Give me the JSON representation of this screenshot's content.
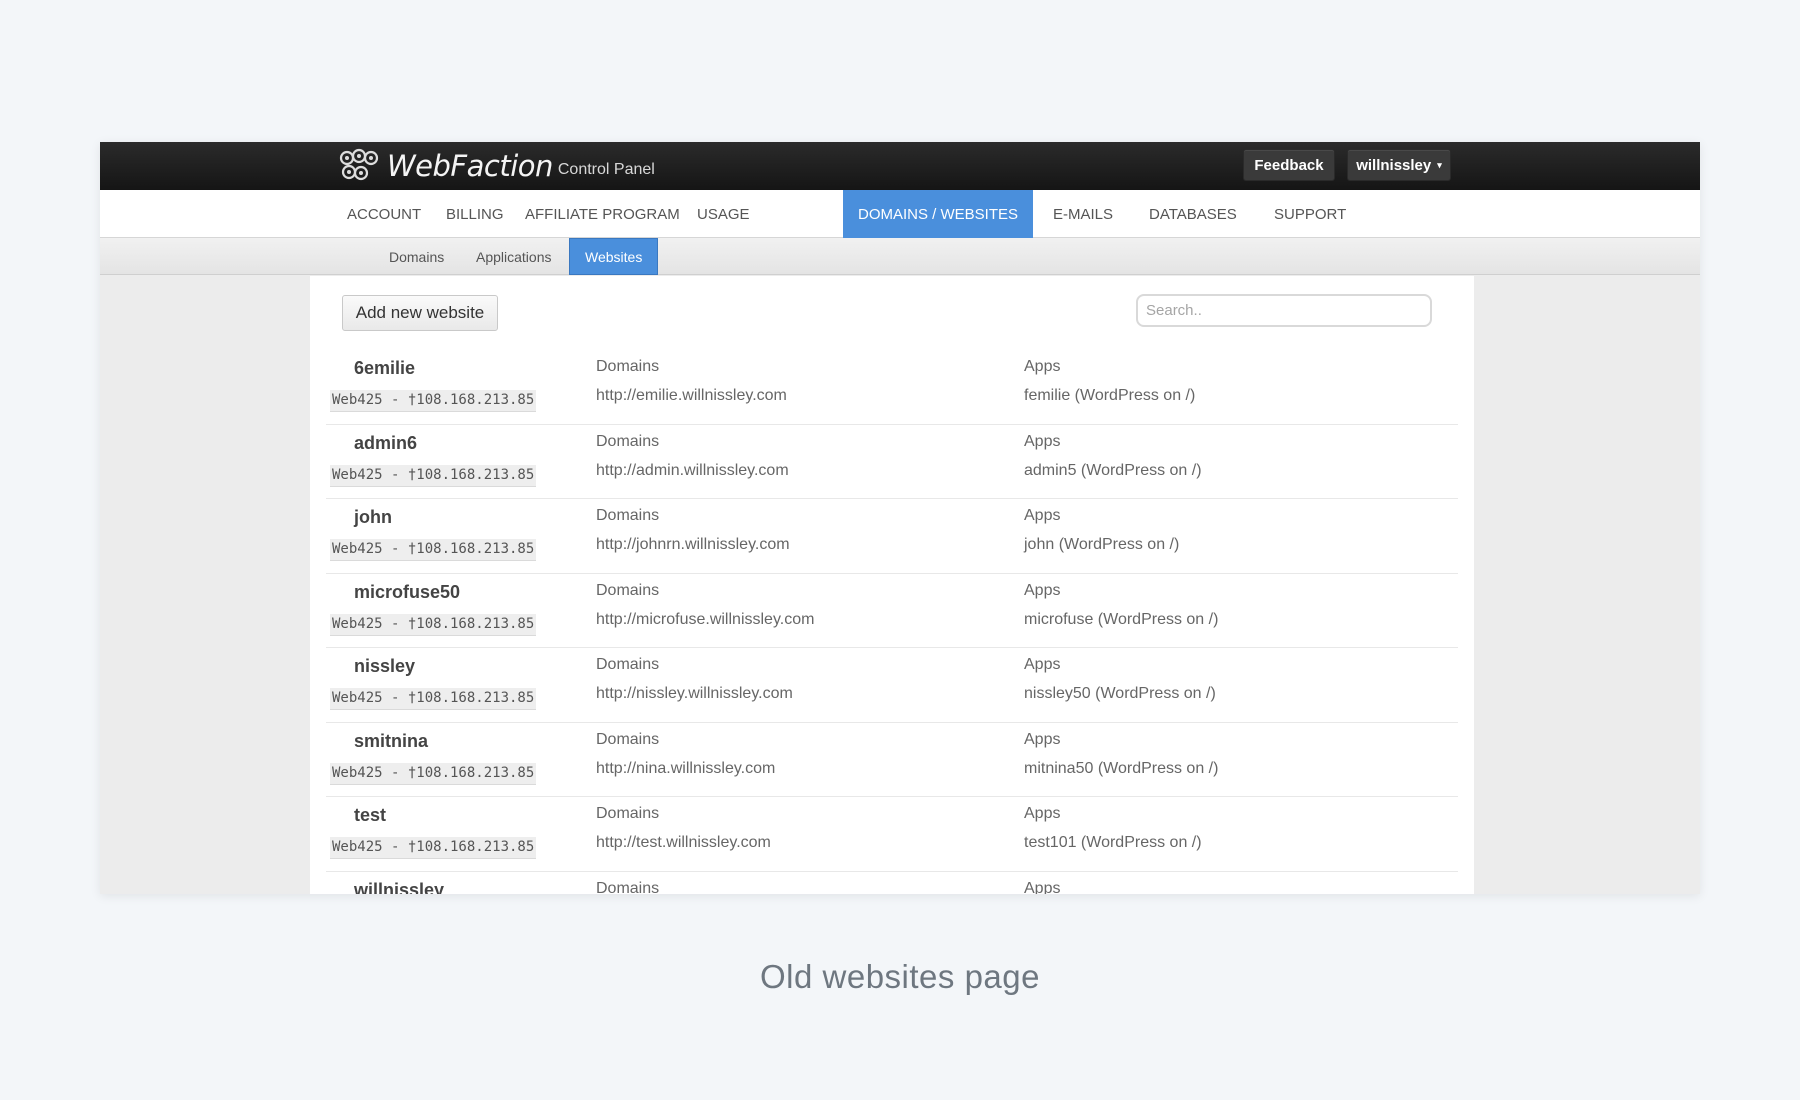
{
  "app": {
    "brand_name": "WebFaction",
    "brand_sub": "Control Panel",
    "feedback_label": "Feedback",
    "user_label": "willnissley",
    "user_caret": "▾"
  },
  "nav": {
    "items": [
      {
        "label": "ACCOUNT"
      },
      {
        "label": "BILLING"
      },
      {
        "label": "AFFILIATE PROGRAM"
      },
      {
        "label": "USAGE"
      },
      {
        "label": "DOMAINS / WEBSITES",
        "active": true
      },
      {
        "label": "E-MAILS"
      },
      {
        "label": "DATABASES"
      },
      {
        "label": "SUPPORT"
      }
    ]
  },
  "subnav": {
    "items": [
      {
        "label": "Domains"
      },
      {
        "label": "Applications"
      },
      {
        "label": "Websites",
        "active": true
      }
    ]
  },
  "main": {
    "add_button": "Add new website",
    "search_placeholder": "Search..",
    "domains_heading": "Domains",
    "apps_heading": "Apps",
    "websites": [
      {
        "name": "6emilie",
        "server": "Web425 - †108.168.213.85",
        "domain": "http://emilie.willnissley.com",
        "app": "femilie (WordPress on /)"
      },
      {
        "name": "admin6",
        "server": "Web425 - †108.168.213.85",
        "domain": "http://admin.willnissley.com",
        "app": "admin5 (WordPress on /)"
      },
      {
        "name": "john",
        "server": "Web425 - †108.168.213.85",
        "domain": "http://johnrn.willnissley.com",
        "app": "john (WordPress on /)"
      },
      {
        "name": "microfuse50",
        "server": "Web425 - †108.168.213.85",
        "domain": "http://microfuse.willnissley.com",
        "app": "microfuse (WordPress on /)"
      },
      {
        "name": "nissley",
        "server": "Web425 - †108.168.213.85",
        "domain": "http://nissley.willnissley.com",
        "app": "nissley50 (WordPress on /)"
      },
      {
        "name": "smitnina",
        "server": "Web425 - †108.168.213.85",
        "domain": "http://nina.willnissley.com",
        "app": "mitnina50 (WordPress on /)"
      },
      {
        "name": "test",
        "server": "Web425 - †108.168.213.85",
        "domain": "http://test.willnissley.com",
        "app": "test101 (WordPress on /)"
      },
      {
        "name": "willnissley",
        "server": "",
        "domain": "",
        "app": ""
      }
    ]
  },
  "caption": "Old websites page",
  "colors": {
    "accent": "#4a8fdc",
    "topbar": "#1c1c1c",
    "page_bg": "#f3f6f9"
  }
}
